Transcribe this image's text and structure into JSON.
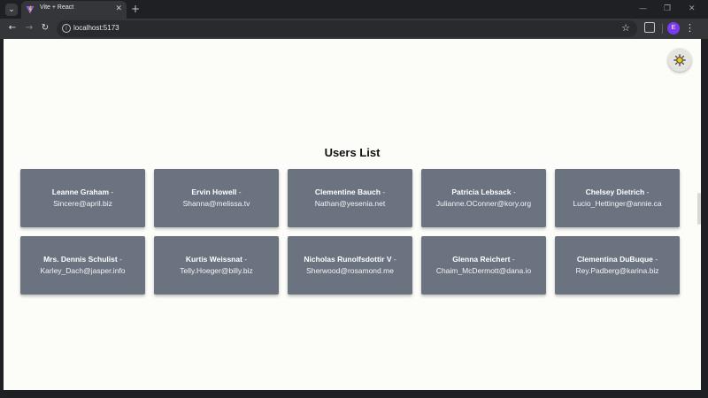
{
  "browser": {
    "tab": {
      "title": "Vite + React",
      "close_glyph": "✕"
    },
    "tab_list_glyph": "⌄",
    "new_tab_glyph": "+",
    "window_controls": {
      "minimize": "—",
      "restore": "❐",
      "close": "✕"
    },
    "nav": {
      "back": "←",
      "forward": "→",
      "reload": "↻"
    },
    "address_bar": {
      "url": "localhost:5173",
      "info_glyph": "i",
      "star_glyph": "☆"
    },
    "profile_initial": "E",
    "menu_glyph": "⋮",
    "icons": [
      "tab-list-icon",
      "vite-favicon",
      "close-icon",
      "plus-icon",
      "minimize-icon",
      "restore-icon",
      "back-arrow-icon",
      "forward-arrow-icon",
      "reload-icon",
      "site-info-icon",
      "star-icon",
      "extensions-icon",
      "kebab-menu-icon",
      "sun-icon"
    ]
  },
  "page": {
    "heading": "Users List",
    "separator": " - ",
    "users": [
      {
        "name": "Leanne Graham",
        "email": "Sincere@april.biz"
      },
      {
        "name": "Ervin Howell",
        "email": "Shanna@melissa.tv"
      },
      {
        "name": "Clementine Bauch",
        "email": "Nathan@yesenia.net"
      },
      {
        "name": "Patricia Lebsack",
        "email": "Julianne.OConner@kory.org"
      },
      {
        "name": "Chelsey Dietrich",
        "email": "Lucio_Hettinger@annie.ca"
      },
      {
        "name": "Mrs. Dennis Schulist",
        "email": "Karley_Dach@jasper.info"
      },
      {
        "name": "Kurtis Weissnat",
        "email": "Telly.Hoeger@billy.biz"
      },
      {
        "name": "Nicholas Runolfsdottir V",
        "email": "Sherwood@rosamond.me"
      },
      {
        "name": "Glenna Reichert",
        "email": "Chaim_McDermott@dana.io"
      },
      {
        "name": "Clementina DuBuque",
        "email": "Rey.Padberg@karina.biz"
      }
    ]
  },
  "colors": {
    "card_bg": "#6b7280",
    "page_bg": "#fcfcf8",
    "sun": "#f5c518",
    "profile": "#7c3aed"
  }
}
